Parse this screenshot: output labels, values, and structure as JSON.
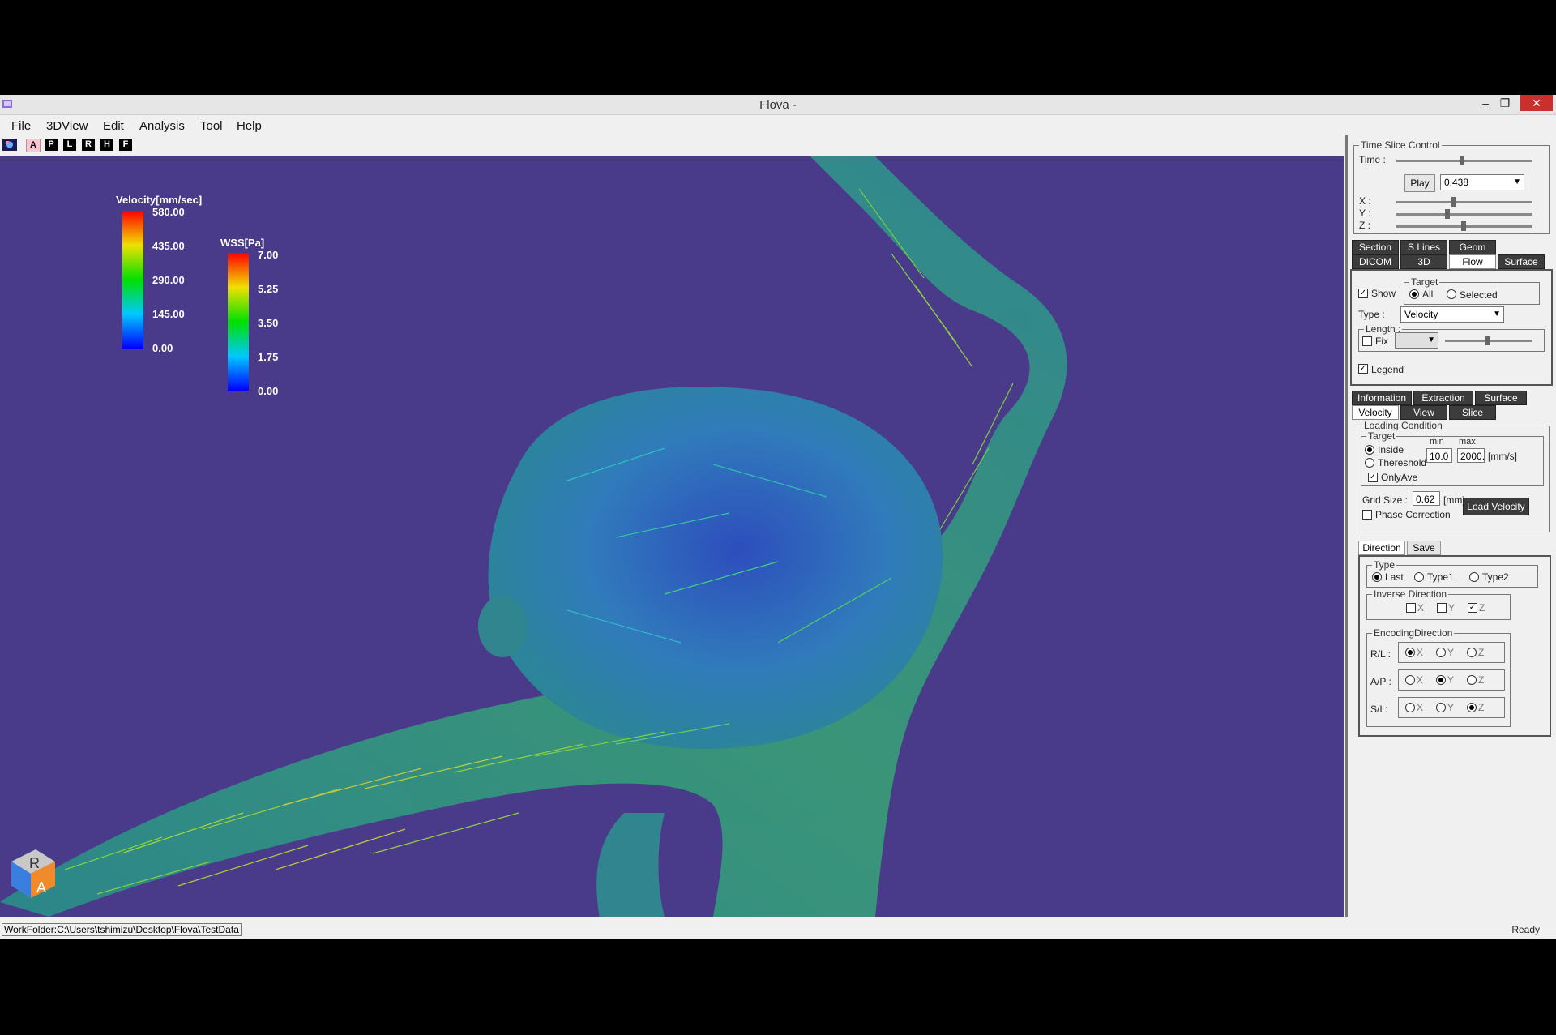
{
  "window": {
    "title": "Flova -",
    "controls": {
      "minimize": "–",
      "restore": "❐",
      "close": "✕"
    }
  },
  "menu": [
    "File",
    "3DView",
    "Edit",
    "Analysis",
    "Tool",
    "Help"
  ],
  "toolbar": {
    "buttons": [
      "A",
      "P",
      "L",
      "R",
      "H",
      "F"
    ]
  },
  "viewport": {
    "background": "#4a3b8a",
    "velocity_legend": {
      "title": "Velocity[mm/sec]",
      "ticks": [
        "580.00",
        "435.00",
        "290.00",
        "145.00",
        "0.00"
      ]
    },
    "wss_legend": {
      "title": "WSS[Pa]",
      "ticks": [
        "7.00",
        "5.25",
        "3.50",
        "1.75",
        "0.00"
      ]
    },
    "orientation_cube": {
      "top": "R",
      "front": "A"
    }
  },
  "status": {
    "workfolder": "WorkFolder:C:\\Users\\tshimizu\\Desktop\\Flova\\TestData",
    "state": "Ready"
  },
  "panel": {
    "time_slice": {
      "label": "Time Slice Control",
      "time_label": "Time :",
      "play_label": "Play",
      "time_value": "0.438",
      "x_label": "X :",
      "y_label": "Y :",
      "z_label": "Z :"
    },
    "tabs_row1": [
      "Section",
      "S Lines",
      "Geom"
    ],
    "tabs_row2": [
      "DICOM",
      "3D",
      "Flow",
      "Surface"
    ],
    "flow": {
      "show_label": "Show",
      "target_label": "Target",
      "target_all": "All",
      "target_selected": "Selected",
      "type_label": "Type :",
      "type_value": "Velocity",
      "length_label": "Length :",
      "fix_label": "Fix",
      "legend_label": "Legend"
    },
    "tabs_row3": [
      "Information",
      "Extraction",
      "Surface"
    ],
    "tabs_row4": [
      "Velocity",
      "View",
      "Slice"
    ],
    "loading": {
      "label": "Loading Condition",
      "target_label": "Target",
      "inside": "Inside",
      "threshold": "Thereshold",
      "min_label": "min",
      "max_label": "max",
      "min_value": "10.0",
      "max_value": "2000.",
      "unit": "[mm/s]",
      "only_ave": "OnlyAve",
      "grid_size_label": "Grid Size :",
      "grid_size_value": "0.62",
      "grid_unit": "[mm]",
      "phase_correction": "Phase Correction",
      "load_button": "Load Velocity"
    },
    "subtabs": [
      "Direction",
      "Save"
    ],
    "direction": {
      "type_label": "Type",
      "type_options": [
        "Last",
        "Type1",
        "Type2"
      ],
      "inverse_label": "Inverse Direction",
      "inverse_options": [
        "X",
        "Y",
        "Z"
      ],
      "encoding_label": "EncodingDirection",
      "rows": [
        "R/L :",
        "A/P :",
        "S/I :"
      ],
      "axes": [
        "X",
        "Y",
        "Z"
      ]
    }
  }
}
